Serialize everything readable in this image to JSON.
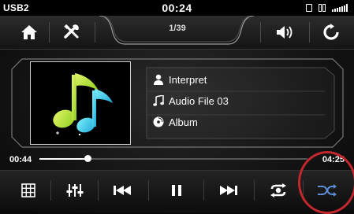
{
  "status_bar": {
    "source": "USB2",
    "clock": "00:24"
  },
  "toolbar": {
    "track_position": "1/39"
  },
  "now_playing": {
    "artist": "Interpret",
    "title": "Audio File 03",
    "album": "Album"
  },
  "progress": {
    "elapsed": "00:44",
    "total": "04:25",
    "fraction": 0.18
  },
  "icons": {
    "home": "home-icon",
    "settings": "tools-icon",
    "volume": "volume-icon",
    "repeat": "refresh-icon",
    "list": "list-icon",
    "equalizer": "equalizer-icon",
    "prev": "skip-back-icon",
    "pause": "pause-icon",
    "next": "skip-forward-icon",
    "repeat_mode": "repeat-icon",
    "shuffle": "shuffle-icon"
  },
  "colors": {
    "accent": "#c1272d",
    "note_green": "#b7e635",
    "note_cyan": "#35c6e8",
    "shuffle_active": "#5b8fd6"
  }
}
